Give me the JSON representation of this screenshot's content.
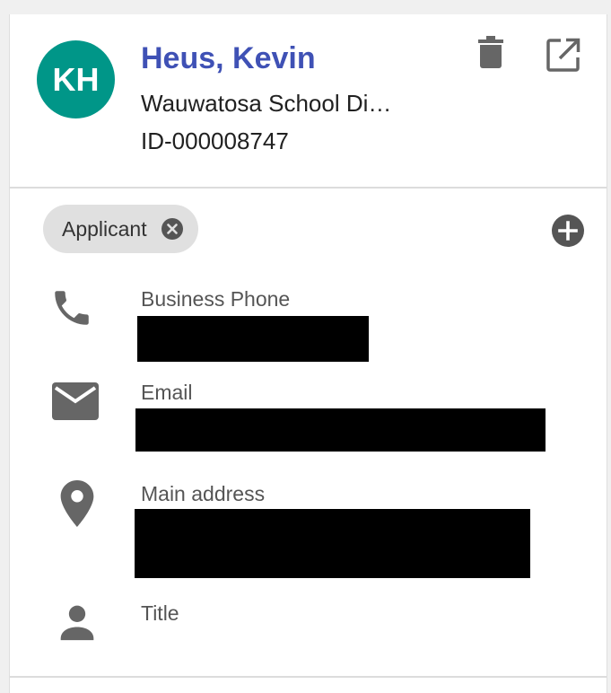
{
  "contact": {
    "initials": "KH",
    "name": "Heus, Kevin",
    "organization": "Wauwatosa School Di…",
    "record_id": "ID-000008747"
  },
  "actions": {
    "delete_icon": "trash-icon",
    "open_icon": "open-in-new-icon"
  },
  "tags": [
    {
      "label": "Applicant"
    }
  ],
  "fields": {
    "business_phone": {
      "label": "Business Phone",
      "icon": "phone-icon"
    },
    "email": {
      "label": "Email",
      "icon": "email-icon"
    },
    "main_address": {
      "label": "Main address",
      "icon": "location-pin-icon"
    },
    "title": {
      "label": "Title",
      "icon": "person-icon"
    }
  },
  "colors": {
    "avatar_bg": "#009688",
    "name": "#3f51b5",
    "icon": "#666666",
    "chip_bg": "#e0e0e0"
  }
}
